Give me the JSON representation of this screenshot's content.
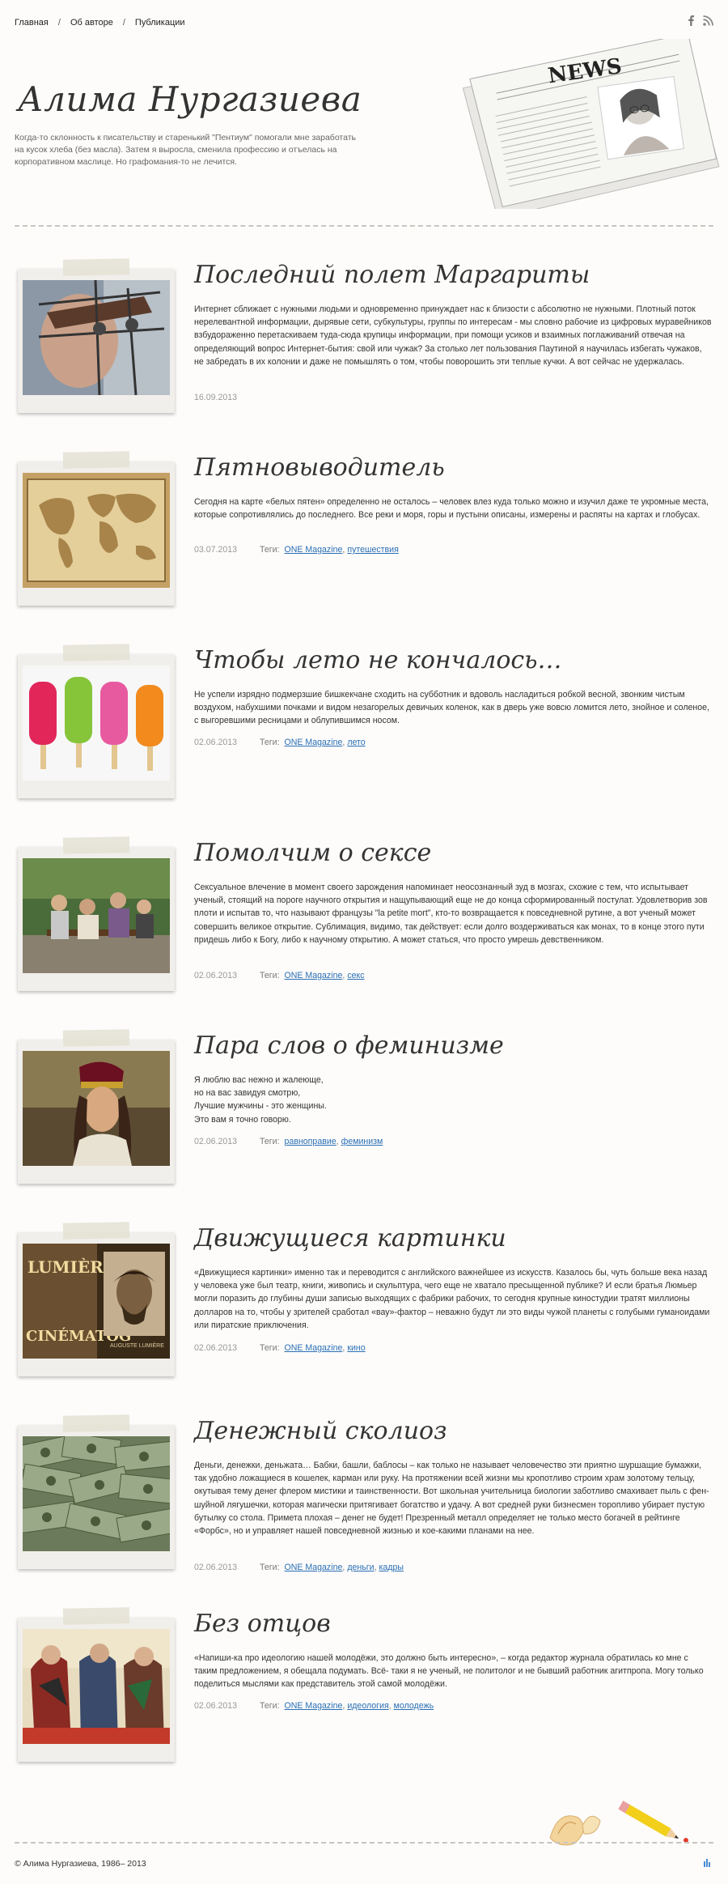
{
  "nav": {
    "items": [
      "Главная",
      "Об авторе",
      "Публикации"
    ],
    "separator": "/"
  },
  "social": {
    "icons": [
      "facebook-icon",
      "rss-icon"
    ]
  },
  "header": {
    "title": "Алима Нургазиева",
    "description": "Когда-то склонность к писательству и старенький \"Пентиум\" помогали мне заработать на кусок хлеба (без масла). Затем я выросла, сменила профессию и отъелась на корпоративном маслице. Но графомания-то не лечится.",
    "newspaper_masthead": "NEWS"
  },
  "tags_label": "Теги:",
  "posts": [
    {
      "title": "Последний полет Маргариты",
      "excerpt": "Интернет сближает с нужными людьми и одновременно принуждает нас к близости с абсолютно не нужными. Плотный поток нерелевантной информации, дырявые сети, субкультуры, группы по интересам - мы словно рабочие из цифровых муравейников взбудораженно перетаскиваем туда-сюда крупицы информации, при помощи усиков и взаимных поглаживаний отвечая на определяющий вопрос Интернет-бытия: свой или чужак? За столько лет пользования Паутиной я научилась избегать чужаков, не забредать в их колонии и даже не помышлять о том, чтобы поворошить эти теплые кучки. А вот сейчас не удержалась.",
      "date": "16.09.2013",
      "tags": []
    },
    {
      "title": "Пятновыводитель",
      "excerpt": "Сегодня на карте «белых пятен» определенно не осталось – человек влез куда только можно и изучил даже те укромные места, которые сопротивлялись до последнего. Все реки и моря, горы и пустыни описаны, измерены и распяты на картах и глобусах.",
      "date": "03.07.2013",
      "tags": [
        "ONE Magazine",
        "путешествия"
      ]
    },
    {
      "title": "Чтобы лето не кончалось…",
      "excerpt": "Не успели изрядно подмерзшие бишкекчане сходить на субботник и вдоволь насладиться робкой весной, звонким чистым воздухом, набухшими почками и видом незагорелых девичьих коленок, как в дверь уже вовсю ломится лето, знойное и соленое, с выгоревшими ресницами и облупившимся носом.",
      "date": "02.06.2013",
      "tags": [
        "ONE Magazine",
        "лето"
      ]
    },
    {
      "title": "Помолчим о сексе",
      "excerpt": "Сексуальное влечение в момент своего зарождения напоминает неосознанный зуд в мозгах, схожие с тем, что испытывает ученый, стоящий на пороге научного открытия и нащупывающий еще не до конца сформированный постулат. Удовлетворив зов плоти и испытав то, что называют французы \"la petite mort\", кто-то возвращается к повседневной рутине, а вот ученый может совершить великое открытие. Сублимация, видимо, так действует: если долго воздерживаться как монах, то в конце этого пути придешь либо к Богу, либо к научному открытию. А может статься, что просто умрешь девственником.",
      "date": "02.06.2013",
      "tags": [
        "ONE Magazine",
        "секс"
      ]
    },
    {
      "title": "Пара слов о феминизме",
      "excerpt_lines": [
        "Я люблю вас нежно и жалеюще,",
        "но на вас завидуя смотрю,",
        "Лучшие мужчины - это женщины.",
        "Это вам я точно говорю."
      ],
      "date": "02.06.2013",
      "tags": [
        "равноправие",
        "феминизм"
      ]
    },
    {
      "title": "Движущиеся картинки",
      "excerpt": "«Движущиеся картинки» именно так и переводится с английского важнейшее из искусств. Казалось бы, чуть больше века назад у человека уже был театр, книги, живопись и скульптура, чего еще не хватало пресыщенной публике? И если братья Люмьер могли поразить до глубины души записью выходящих с фабрики рабочих, то сегодня крупные киностудии тратят миллионы долларов на то, чтобы у зрителей сработал «вау»-фактор – неважно будут ли это виды чужой планеты с голубыми гуманоидами или пиратские приключения.",
      "date": "02.06.2013",
      "tags": [
        "ONE Magazine",
        "кино"
      ],
      "poster_text": [
        "LUMIÈRES",
        "CINÉMATOG",
        "AUGUSTE LUMIÈRE"
      ]
    },
    {
      "title": "Денежный сколиоз",
      "excerpt": "Деньги, денежки, деньжата… Бабки, башли, баблосы – как только не называет человечество эти приятно шуршащие бумажки, так удобно ложащиеся в кошелек, карман или руку. На протяжении всей жизни мы кропотливо строим храм золотому тельцу, окутывая тему денег флером мистики и таинственности. Вот школьная учительница биологии заботливо смахивает пыль с фен-шуйной лягушечки, которая магически притягивает богатство и удачу. А вот средней руки бизнесмен торопливо убирает пустую бутылку со стола. Примета плохая – денег не будет! Презренный металл определяет не только место богачей в рейтинге «Форбс», но и управляет нашей повседневной жизнью и кое-какими планами на нее.",
      "date": "02.06.2013",
      "tags": [
        "ONE Magazine",
        "деньги",
        "кадры"
      ]
    },
    {
      "title": "Без отцов",
      "excerpt": "«Напиши-ка про идеологию нашей молодёжи, это должно быть интересно», – когда редактор журнала обратилась ко мне с таким предложением, я обещала подумать. Всё- таки я не ученый, не политолог и не бывший работник агитпропа. Могу только поделиться мыслями как представитель этой самой молодёжи.",
      "date": "02.06.2013",
      "tags": [
        "ONE Magazine",
        "идеология",
        "молодежь"
      ]
    }
  ],
  "footer": {
    "copyright": "© Алима Нургазиева, 1986– 2013"
  }
}
